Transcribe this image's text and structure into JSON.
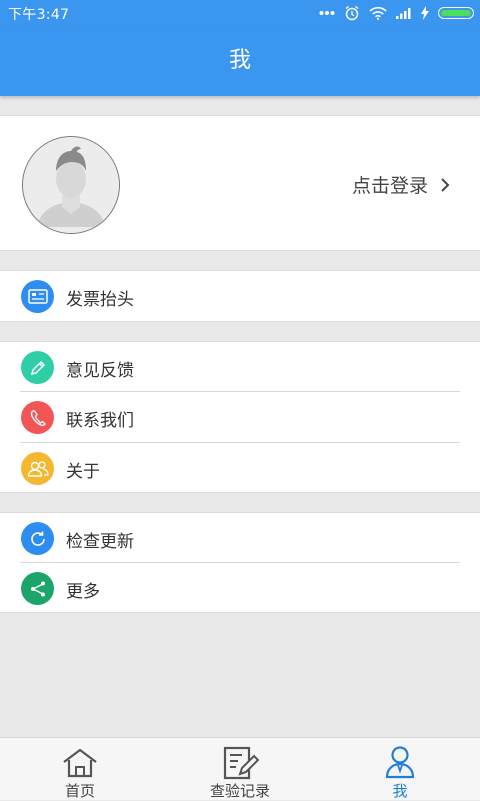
{
  "status_bar": {
    "time": "下午3:47",
    "battery_color": "#4ce05a"
  },
  "app_bar": {
    "title": "我",
    "color": "#3a96ee"
  },
  "profile": {
    "login_text": "点击登录"
  },
  "sections": {
    "invoice": {
      "label": "发票抬头",
      "icon": "invoice-card-icon",
      "color": "#2e8df0"
    },
    "feedback": {
      "label": "意见反馈",
      "icon": "pencil-icon",
      "color": "#2ecfa7"
    },
    "contact": {
      "label": "联系我们",
      "icon": "phone-icon",
      "color": "#f25555"
    },
    "about": {
      "label": "关于",
      "icon": "people-icon",
      "color": "#f5b72f"
    },
    "update": {
      "label": "检查更新",
      "icon": "refresh-icon",
      "color": "#2e8df0"
    },
    "more": {
      "label": "更多",
      "icon": "share-icon",
      "color": "#1ba56b"
    }
  },
  "tabs": [
    {
      "label": "首页",
      "icon": "home-icon",
      "active": false
    },
    {
      "label": "查验记录",
      "icon": "records-icon",
      "active": false
    },
    {
      "label": "我",
      "icon": "user-icon",
      "active": true
    }
  ]
}
